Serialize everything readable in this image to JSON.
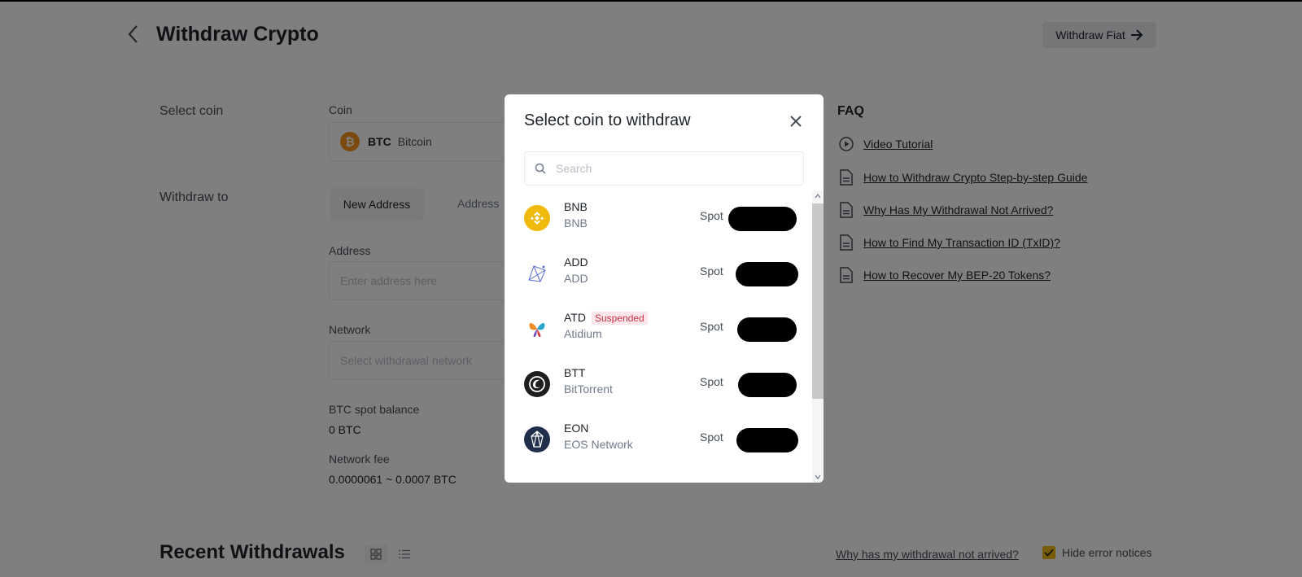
{
  "page": {
    "title": "Withdraw Crypto",
    "fiat_button": "Withdraw Fiat"
  },
  "form": {
    "select_coin_label": "Select coin",
    "coin_field_label": "Coin",
    "coin_symbol": "BTC",
    "coin_name": "Bitcoin",
    "withdraw_to_label": "Withdraw to",
    "tab_new_address": "New Address",
    "tab_address_book": "Address",
    "address_label": "Address",
    "address_placeholder": "Enter address here",
    "network_label": "Network",
    "network_placeholder": "Select withdrawal network",
    "balance_label": "BTC spot balance",
    "balance_value": "0 BTC",
    "fee_label": "Network fee",
    "fee_value": "0.0000061 ~ 0.0007 BTC"
  },
  "faq": {
    "title": "FAQ",
    "items": [
      {
        "label": "Video Tutorial",
        "icon": "play-circle-icon"
      },
      {
        "label": "How to Withdraw Crypto Step-by-step Guide",
        "icon": "document-icon"
      },
      {
        "label": "Why Has My Withdrawal Not Arrived?",
        "icon": "document-icon"
      },
      {
        "label": "How to Find My Transaction ID (TxID)?",
        "icon": "document-icon"
      },
      {
        "label": "How to Recover My BEP-20 Tokens?",
        "icon": "document-icon"
      }
    ]
  },
  "recent": {
    "title": "Recent Withdrawals",
    "not_arrived_link": "Why has my withdrawal not arrived?",
    "hide_errors_label": "Hide error notices",
    "hide_errors_checked": true
  },
  "modal": {
    "title": "Select coin to withdraw",
    "search_placeholder": "Search",
    "coins": [
      {
        "symbol": "BNB",
        "name": "BNB",
        "wallet": "Spot",
        "icon": "bnb-icon"
      },
      {
        "symbol": "ADD",
        "name": "ADD",
        "wallet": "Spot",
        "icon": "add-icon"
      },
      {
        "symbol": "ATD",
        "name": "Atidium",
        "wallet": "Spot",
        "badge": "Suspended",
        "icon": "atd-icon"
      },
      {
        "symbol": "BTT",
        "name": "BitTorrent",
        "wallet": "Spot",
        "icon": "btt-icon"
      },
      {
        "symbol": "EON",
        "name": "EOS Network",
        "wallet": "Spot",
        "icon": "eon-icon"
      }
    ]
  },
  "colors": {
    "brand_yellow": "#f0b90b",
    "btc_orange": "#f7931a",
    "suspended_red": "#cf304a"
  }
}
